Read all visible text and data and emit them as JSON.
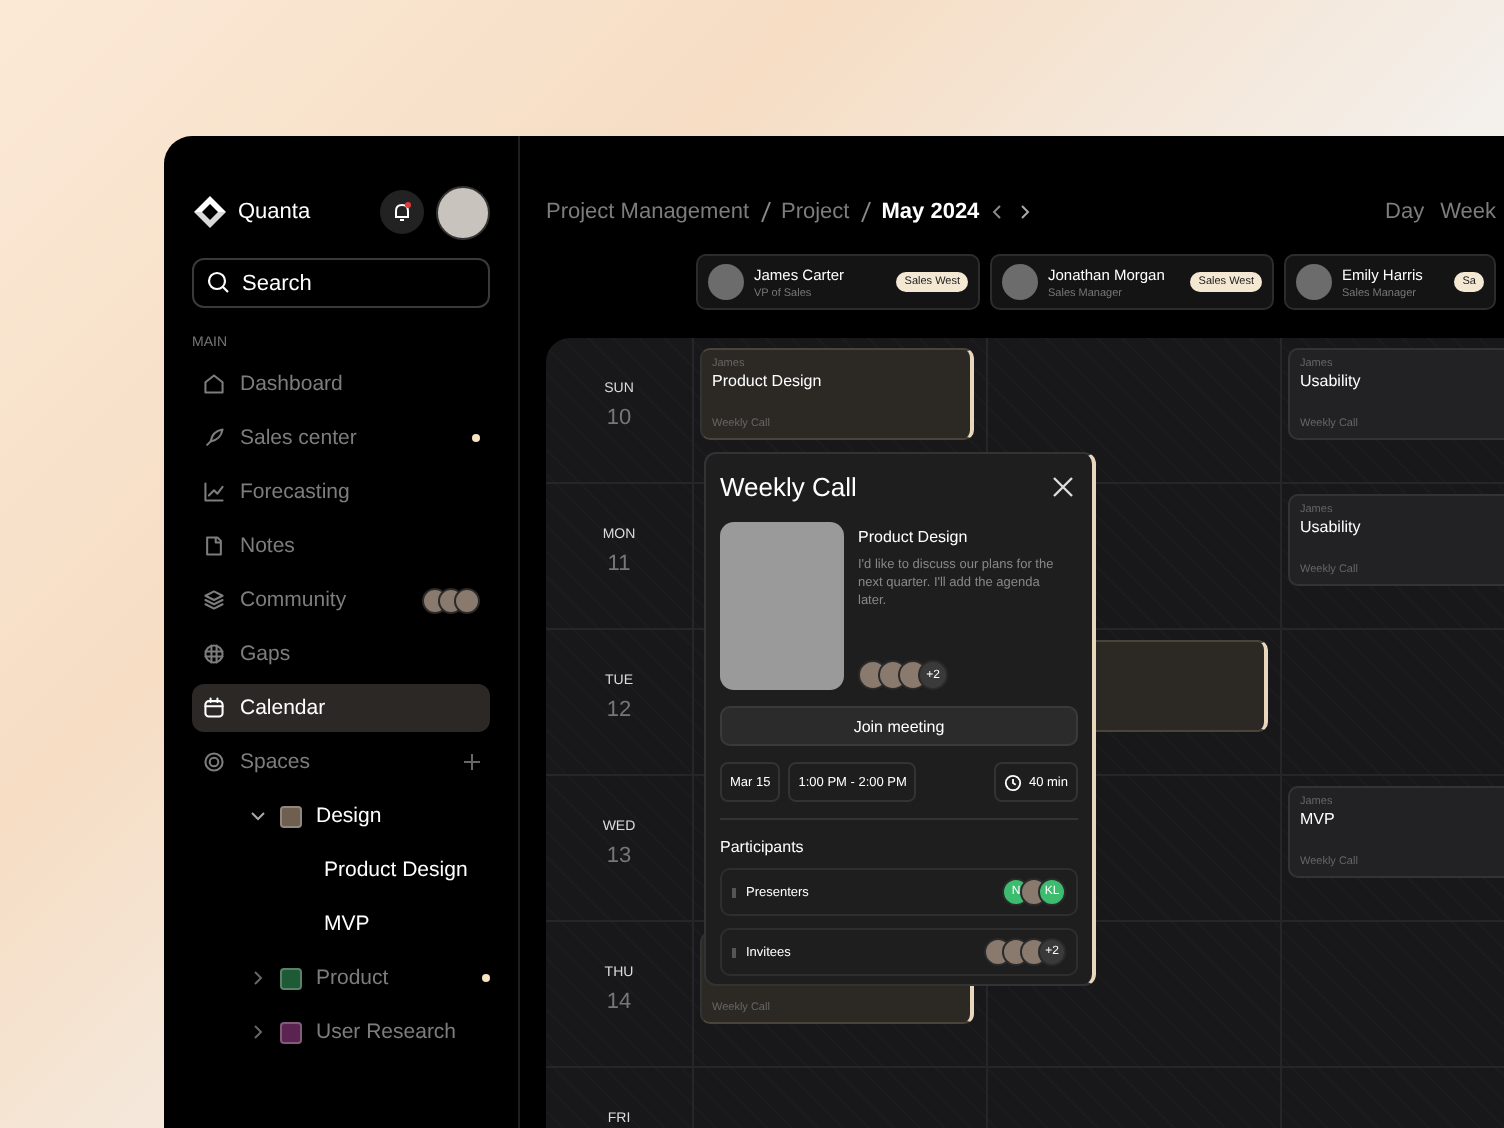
{
  "sidebar": {
    "brand": "Quanta",
    "search": {
      "placeholder": "Search"
    },
    "section": "MAIN",
    "items": [
      {
        "kind": "link",
        "label": "Dashboard",
        "selected": false,
        "unread": false
      },
      {
        "kind": "link",
        "label": "Sales center",
        "selected": false,
        "unread": true
      },
      {
        "kind": "link",
        "label": "Forecasting",
        "selected": false,
        "unread": false
      },
      {
        "kind": "link",
        "label": "Notes",
        "selected": false,
        "unread": false
      },
      {
        "kind": "members",
        "label": "Community",
        "selected": false,
        "unread": false
      },
      {
        "kind": "link",
        "label": "Gaps",
        "selected": false,
        "unread": false
      },
      {
        "kind": "link",
        "label": "Calendar",
        "selected": true,
        "unread": false
      },
      {
        "kind": "group",
        "label": "Spaces",
        "selected": false,
        "unread": false,
        "children": [
          {
            "label": "Design",
            "color": "#6e5f50",
            "expanded": true,
            "unread": false,
            "children": [
              {
                "label": "Product Design"
              },
              {
                "label": "MVP"
              }
            ]
          },
          {
            "label": "Product",
            "color": "#1e5a36",
            "expanded": false,
            "unread": true
          },
          {
            "label": "User Research",
            "color": "#5a2350",
            "expanded": false,
            "unread": false
          }
        ]
      }
    ]
  },
  "breadcrumb": [
    {
      "label": "Project Management",
      "current": false
    },
    {
      "label": "Project",
      "current": false
    },
    {
      "label": "May 2024",
      "current": true
    }
  ],
  "views": [
    {
      "label": "Day",
      "selected": false
    },
    {
      "label": "Week",
      "selected": false
    }
  ],
  "people": [
    {
      "name": "James Carter",
      "role": "VP of Sales",
      "tag": "Sales West"
    },
    {
      "name": "Jonathan Morgan",
      "role": "Sales Manager",
      "tag": "Sales West"
    },
    {
      "name": "Emily Harris",
      "role": "Sales Manager",
      "tag": "Sa"
    }
  ],
  "calendar": {
    "rows": [
      {
        "day": "SUN",
        "date": "10",
        "cells": [
          {
            "kind": "event",
            "owner": "James",
            "title": "Product Design",
            "subtitle": "Weekly Call",
            "highlighted": true
          },
          {
            "kind": "empty"
          },
          {
            "kind": "event",
            "owner": "James",
            "title": "Usability",
            "subtitle": "Weekly Call",
            "highlighted": false
          }
        ]
      },
      {
        "day": "MON",
        "date": "11",
        "cells": [
          {
            "kind": "empty"
          },
          {
            "kind": "empty"
          },
          {
            "kind": "event",
            "owner": "James",
            "title": "Usability",
            "subtitle": "Weekly Call",
            "highlighted": false
          }
        ]
      },
      {
        "day": "TUE",
        "date": "12",
        "cells": [
          {
            "kind": "empty"
          },
          {
            "kind": "event",
            "highlighted": true
          },
          {
            "kind": "empty"
          }
        ]
      },
      {
        "day": "WED",
        "date": "13",
        "cells": [
          {
            "kind": "empty"
          },
          {
            "kind": "empty"
          },
          {
            "kind": "event",
            "owner": "James",
            "title": "MVP",
            "subtitle": "Weekly Call",
            "highlighted": false
          }
        ]
      },
      {
        "day": "THU",
        "date": "14",
        "cells": [
          {
            "kind": "event",
            "subtitle": "Weekly Call",
            "highlighted": true
          },
          {
            "kind": "empty"
          },
          {
            "kind": "empty"
          }
        ]
      },
      {
        "day": "FRI",
        "cells": [
          {
            "kind": "empty"
          },
          {
            "kind": "empty"
          },
          {
            "kind": "empty"
          }
        ]
      }
    ]
  },
  "popup": {
    "title": "Weekly Call",
    "subtitle": "Product Design",
    "description": "I'd like to discuss our plans for the next quarter. I'll add the agenda later.",
    "avatars": [
      {
        "kind": "photo"
      },
      {
        "kind": "photo"
      },
      {
        "kind": "photo"
      },
      {
        "kind": "more",
        "text": "+2"
      }
    ],
    "join": "Join meeting",
    "date": "Mar 15",
    "time": "1:00 PM - 2:00 PM",
    "duration": "40 min",
    "participants_title": "Participants",
    "groups": [
      {
        "label": "Presenters",
        "avatars": [
          {
            "kind": "initials",
            "text": "N"
          },
          {
            "kind": "photo"
          },
          {
            "kind": "initials",
            "text": "KL"
          }
        ]
      },
      {
        "label": "Invitees",
        "avatars": [
          {
            "kind": "photo"
          },
          {
            "kind": "photo"
          },
          {
            "kind": "photo"
          },
          {
            "kind": "more",
            "text": "+2"
          }
        ]
      }
    ]
  }
}
